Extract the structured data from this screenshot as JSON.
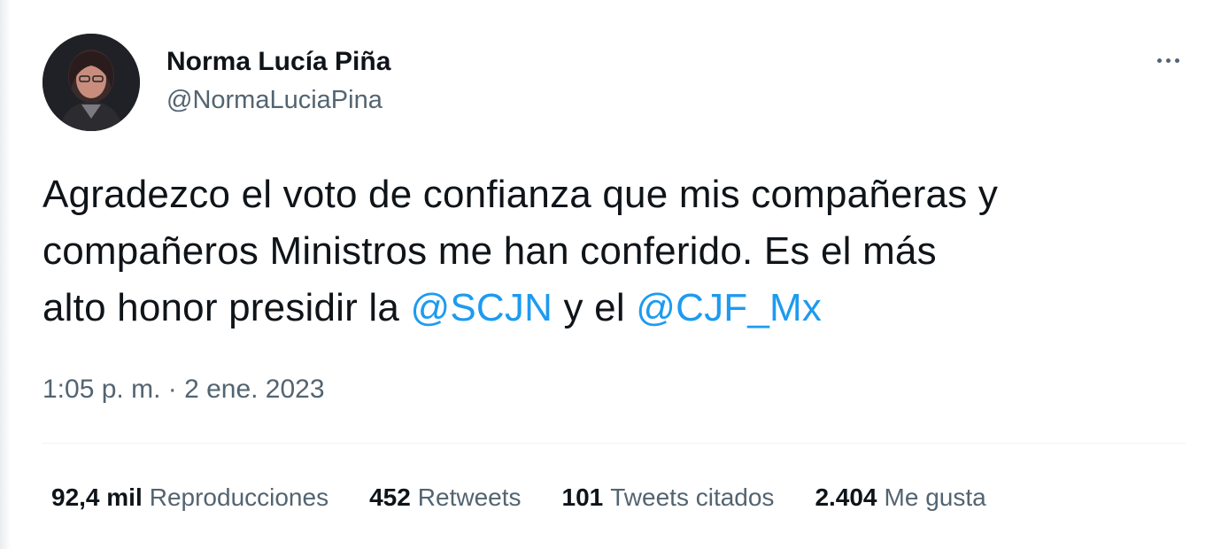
{
  "author": {
    "display_name": "Norma Lucía Piña",
    "handle": "@NormaLuciaPina"
  },
  "more_icon": "more-horizontal-icon",
  "tweet": {
    "line1": "Agradezco el voto de confianza que mis compañeras y",
    "line2": "compañeros Ministros me han conferido. Es el más",
    "line3_prefix": "alto honor presidir la",
    "mention1": "@SCJN",
    "middle": "y el",
    "mention2": "@CJF_Mx"
  },
  "timestamp": "1:05 p. m. · 2 ene. 2023",
  "stats": [
    {
      "value": "92,4 mil",
      "label": "Reproducciones"
    },
    {
      "value": "452",
      "label": "Retweets"
    },
    {
      "value": "101",
      "label": "Tweets citados"
    },
    {
      "value": "2.404",
      "label": "Me gusta"
    }
  ],
  "colors": {
    "link": "#1d9bf0",
    "secondary_text": "#536471",
    "primary_text": "#0f1419"
  }
}
